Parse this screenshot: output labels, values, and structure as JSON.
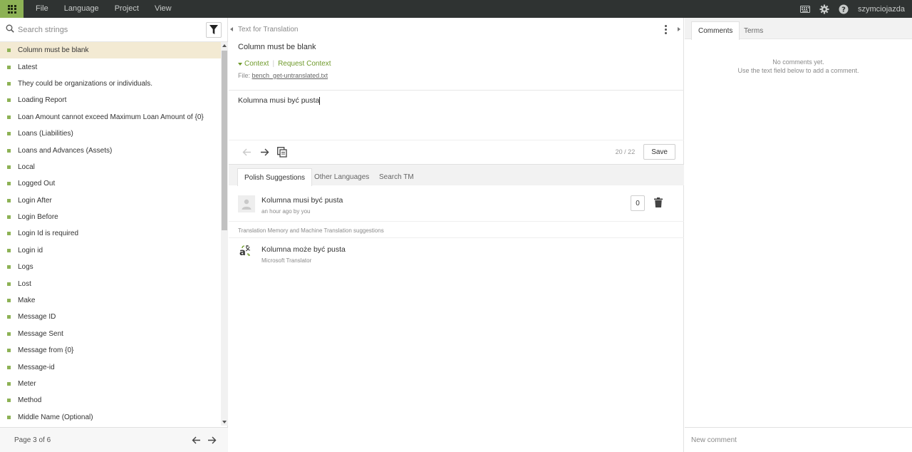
{
  "topbar": {
    "menu": [
      "File",
      "Language",
      "Project",
      "View"
    ],
    "username": "szymciojazda",
    "accent": "#8db255",
    "bg": "#2f3332"
  },
  "left": {
    "search_placeholder": "Search strings",
    "items": [
      "Column must be blank",
      "Latest",
      "They could be organizations or individuals.",
      "Loading Report",
      "Loan Amount cannot exceed Maximum Loan Amount of {0}",
      "Loans (Liabilities)",
      "Loans and Advances (Assets)",
      "Local",
      "Logged Out",
      "Login After",
      "Login Before",
      "Login Id is required",
      "Login id",
      "Logs",
      "Lost",
      "Make",
      "Message ID",
      "Message Sent",
      "Message from {0}",
      "Message-id",
      "Meter",
      "Method",
      "Middle Name (Optional)"
    ],
    "selected_index": 0,
    "page_info": "Page 3 of 6"
  },
  "editor": {
    "source_header": "Text for Translation",
    "source_text": "Column must be blank",
    "context_label": "Context",
    "request_context_label": "Request Context",
    "file_label": "File:",
    "file_name": "bench_get-untranslated.txt",
    "translation": "Kolumna musi być pusta",
    "counter": "20 / 22",
    "save_label": "Save"
  },
  "suggestions": {
    "tabs": [
      "Polish Suggestions",
      "Other Languages",
      "Search TM"
    ],
    "active_tab": 0,
    "own": {
      "text": "Kolumna musi być pusta",
      "meta": "an hour ago by you",
      "votes": "0"
    },
    "tm_header": "Translation Memory and Machine Translation suggestions",
    "mt": {
      "text": "Kolumna może być pusta",
      "source": "Microsoft Translator"
    }
  },
  "right": {
    "tabs": [
      "Comments",
      "Terms"
    ],
    "no_comments_line1": "No comments yet.",
    "no_comments_line2": "Use the text field below to add a comment.",
    "comment_placeholder": "New comment"
  }
}
